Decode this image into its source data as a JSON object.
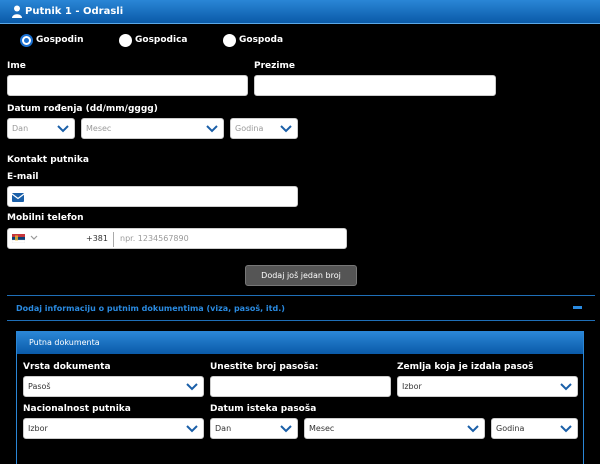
{
  "header": {
    "title": "Putnik 1 - Odrasli"
  },
  "salutation": {
    "options": [
      "Gospodin",
      "Gospodica",
      "Gospoda"
    ],
    "selected": "Gospodin"
  },
  "fields": {
    "first_name_label": "Ime",
    "last_name_label": "Prezime",
    "dob_label": "Datum rođenja (dd/mm/gggg)",
    "dob_day": "Dan",
    "dob_month": "Mesec",
    "dob_year": "Godina"
  },
  "contact": {
    "section_label": "Kontakt putnika",
    "email_label": "E-mail",
    "phone_label": "Mobilni telefon",
    "phone_code": "+381",
    "phone_placeholder": "npr. 1234567890",
    "add_number_button": "Dodaj još jedan broj"
  },
  "documents": {
    "toggle_label": "Dodaj informaciju o putnim dokumentima (viza, pasoš, itd.)",
    "panel_title": "Putna dokumenta",
    "doc_type_label": "Vrsta dokumenta",
    "doc_type_value": "Pasoš",
    "passport_number_label": "Unestite broj pasoša:",
    "issuing_country_label": "Zemlja koja je izdala pasoš",
    "issuing_country_value": "Izbor",
    "nationality_label": "Nacionalnost putnika",
    "nationality_value": "Izbor",
    "expiry_label": "Datum isteka pasoša",
    "expiry_day": "Dan",
    "expiry_month": "Mesec",
    "expiry_year": "Godina"
  },
  "colors": {
    "accent": "#1a6fd0",
    "header": "#2a86d6",
    "link": "#2a8ae0"
  }
}
